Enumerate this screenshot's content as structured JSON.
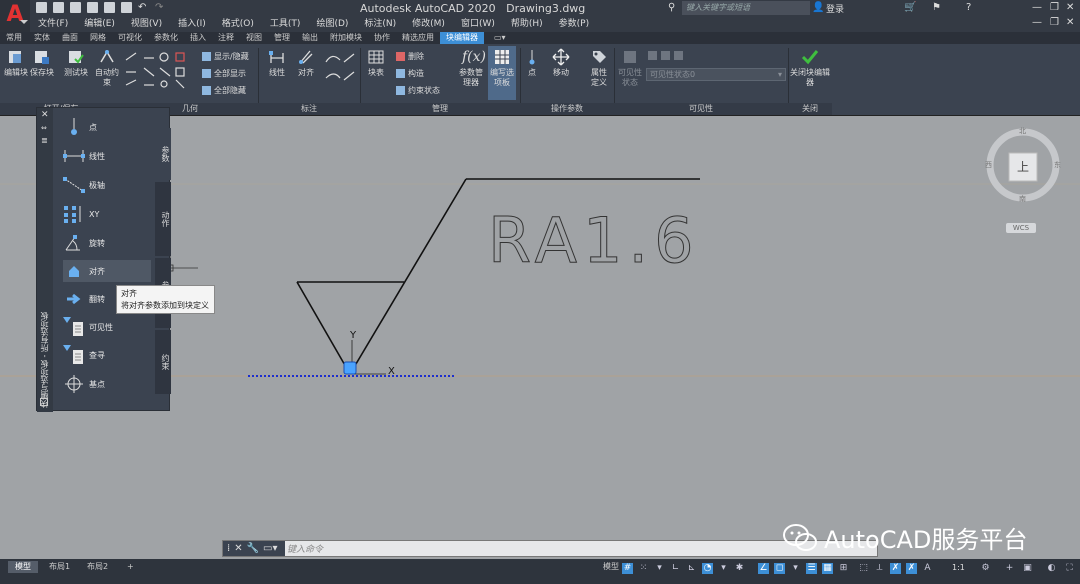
{
  "titlebar": {
    "app_title": "Autodesk AutoCAD 2020",
    "file_name": "Drawing3.dwg",
    "search_placeholder": "键入关键字或短语",
    "login": "登录"
  },
  "menu": [
    "文件(F)",
    "编辑(E)",
    "视图(V)",
    "插入(I)",
    "格式(O)",
    "工具(T)",
    "绘图(D)",
    "标注(N)",
    "修改(M)",
    "窗口(W)",
    "帮助(H)",
    "参数(P)"
  ],
  "tabs": [
    "常用",
    "实体",
    "曲面",
    "网格",
    "可视化",
    "参数化",
    "插入",
    "注释",
    "视图",
    "管理",
    "输出",
    "附加模块",
    "协作",
    "精选应用",
    "块编辑器"
  ],
  "active_tab": "块编辑器",
  "ribbon": {
    "edit_block": "编辑块",
    "save_block": "保存块",
    "test_block": "测试块",
    "auto_constrain": "自动约束",
    "show_hide": "显示/隐藏",
    "show_all": "全部显示",
    "hide_all": "全部隐藏",
    "linear": "线性",
    "align": "对齐",
    "block_table": "块表",
    "delete": "删除",
    "construct": "构造",
    "constraint_status": "约束状态",
    "param_manager": "参数管理器",
    "authoring_palettes": "编写选项板",
    "point": "点",
    "move": "移动",
    "attr_def": "属性定义",
    "visibility_state": "可见性状态",
    "visibility_dropdown": "可见性状态0",
    "close_editor": "关闭块编辑器",
    "panel_open_save": "打开/保存",
    "panel_geometry": "几何",
    "panel_dimension": "标注",
    "panel_manage": "管理",
    "panel_action_params": "操作参数",
    "panel_visibility": "可见性",
    "panel_close": "关闭"
  },
  "palette": {
    "title": "块编写选项板 - 所有选项板",
    "items": [
      "点",
      "线性",
      "极轴",
      "XY",
      "旋转",
      "对齐",
      "翻转",
      "可见性",
      "查寻",
      "基点"
    ],
    "tabs": [
      "参数",
      "动作",
      "参数集",
      "约束"
    ],
    "tooltip_title": "对齐",
    "tooltip_desc": "将对齐参数添加到块定义"
  },
  "drawing": {
    "text": "RA1.6",
    "x_label": "X",
    "y_label": "Y"
  },
  "viewcube": {
    "face": "上",
    "north": "北",
    "south": "南",
    "east": "东",
    "west": "西",
    "wcs": "WCS"
  },
  "command": {
    "placeholder": "键入命令"
  },
  "status": {
    "layouts": [
      "模型",
      "布局1",
      "布局2"
    ],
    "model_label": "模型",
    "scale": "1:1"
  },
  "watermark": "AutoCAD服务平台",
  "colors": {
    "ribbon_bg": "#3b4350",
    "active_tab": "#3d8fd6",
    "canvas": "#a0a3a6",
    "block_grip": "#4aa3ff"
  }
}
